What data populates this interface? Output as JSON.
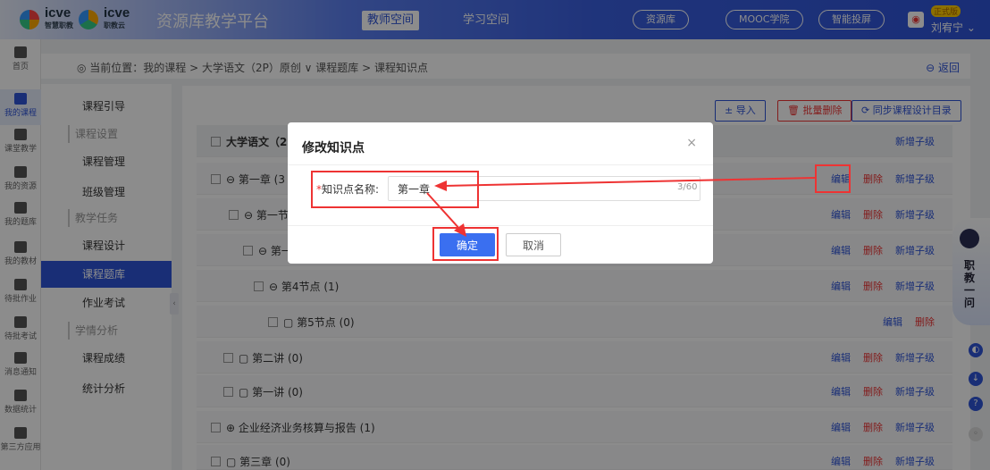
{
  "header": {
    "logo_text": "icve",
    "logo_sub": "智慧职教",
    "logo2_text": "icve",
    "logo2_sub": "职教云",
    "platform": "资源库教学平台",
    "space_teacher": "教师空间",
    "space_learn": "学习空间",
    "pill_resource": "资源库",
    "pill_mooc": "MOOC学院",
    "pill_screen": "智能投屏",
    "user_badge": "正式版",
    "user_name": "刘宥宁"
  },
  "leftnav": [
    {
      "label": "首页"
    },
    {
      "label": "我的课程"
    },
    {
      "label": "课堂教学"
    },
    {
      "label": "我的资源"
    },
    {
      "label": "我的题库"
    },
    {
      "label": "我的教材"
    },
    {
      "label": "待批作业"
    },
    {
      "label": "待批考试"
    },
    {
      "label": "消息通知"
    },
    {
      "label": "数据统计"
    },
    {
      "label": "第三方应用"
    }
  ],
  "subnav": {
    "guide": "课程引导",
    "settings_head": "课程设置",
    "manage": "课程管理",
    "class_manage": "班级管理",
    "tasks_head": "教学任务",
    "design": "课程设计",
    "bank": "课程题库",
    "homework": "作业考试",
    "analysis_head": "学情分析",
    "grades": "课程成绩",
    "stats": "统计分析"
  },
  "breadcrumb": {
    "text": "当前位置：我的课程 > 大学语文（2P）原创 ∨ 课程题库 > 课程知识点",
    "back": "返回"
  },
  "toolbar": {
    "import": "导入",
    "batch_delete": "批量删除",
    "sync": "同步课程设计目录"
  },
  "rows": [
    {
      "label": "大学语文（2P",
      "ops": [
        "新增子级"
      ]
    },
    {
      "label": "⊖ 第一章 (3",
      "ops": [
        "编辑",
        "删除",
        "新增子级"
      ]
    },
    {
      "label": "⊖ 第一节",
      "ops": [
        "编辑",
        "删除",
        "新增子级"
      ]
    },
    {
      "label": "⊖ 第一",
      "ops": [
        "编辑",
        "删除",
        "新增子级"
      ]
    },
    {
      "label": "⊖ 第4节点 (1)",
      "ops": [
        "编辑",
        "删除",
        "新增子级"
      ]
    },
    {
      "label": "第5节点 (0)",
      "ops": [
        "编辑",
        "删除"
      ]
    },
    {
      "label": "第二讲 (0)",
      "ops": [
        "编辑",
        "删除",
        "新增子级"
      ]
    },
    {
      "label": "第一讲 (0)",
      "ops": [
        "编辑",
        "删除",
        "新增子级"
      ]
    },
    {
      "label": "⊕ 企业经济业务核算与报告 (1)",
      "ops": [
        "编辑",
        "删除",
        "新增子级"
      ]
    },
    {
      "label": "第三章 (0)",
      "ops": [
        "编辑",
        "删除",
        "新增子级"
      ]
    }
  ],
  "modal": {
    "title": "修改知识点",
    "close": "×",
    "field_label": "知识点名称:",
    "field_required": "*",
    "field_value": "第一章",
    "counter": "3/60",
    "ok": "确定",
    "cancel": "取消"
  },
  "robot": {
    "text": "职教一问"
  },
  "colors": {
    "accent": "#2f54d8",
    "danger": "#e33333",
    "highlight": "#e33333"
  }
}
